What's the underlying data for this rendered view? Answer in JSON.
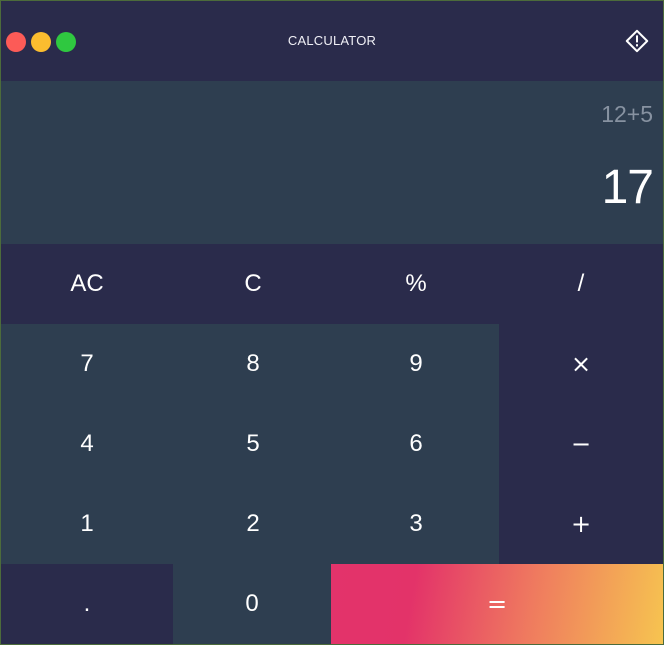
{
  "window": {
    "title": "CALCULATOR"
  },
  "display": {
    "expression": "12+5",
    "result": "17"
  },
  "keys": {
    "ac": "AC",
    "c": "C",
    "percent": "%",
    "divide": "/",
    "seven": "7",
    "eight": "8",
    "nine": "9",
    "multiply": "×",
    "four": "4",
    "five": "5",
    "six": "6",
    "minus": "−",
    "one": "1",
    "two": "2",
    "three": "3",
    "plus": "+",
    "dot": ".",
    "zero": "0",
    "equals": "="
  },
  "colors": {
    "titlebar_bg": "#2a2b4b",
    "display_bg": "#2e3e50",
    "close": "#fc5b57",
    "minimize": "#fbbd2f",
    "maximize": "#2fc840",
    "equals_start": "#e3336b",
    "equals_end": "#f6c450"
  }
}
